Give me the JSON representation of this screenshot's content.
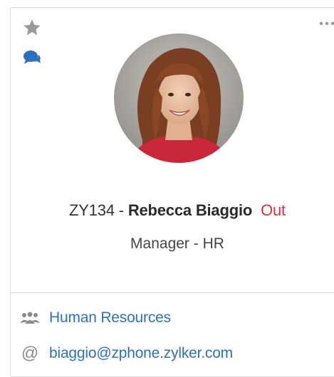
{
  "profile": {
    "employee_id": "ZY134",
    "separator": " - ",
    "name": "Rebecca Biaggio",
    "status": "Out",
    "designation": "Manager - HR",
    "department": "Human Resources",
    "email": "biaggio@zphone.zylker.com"
  },
  "icons": {
    "favorite": "star-icon",
    "chat": "chat-icon",
    "more": "more-options-icon",
    "department": "people-icon",
    "email": "at-icon"
  },
  "colors": {
    "link": "#2f6fbf",
    "status_out": "#d9333f",
    "icon_gray": "#8a8a8a",
    "chat_blue": "#2f6fbf",
    "border": "#dcdcdc"
  }
}
